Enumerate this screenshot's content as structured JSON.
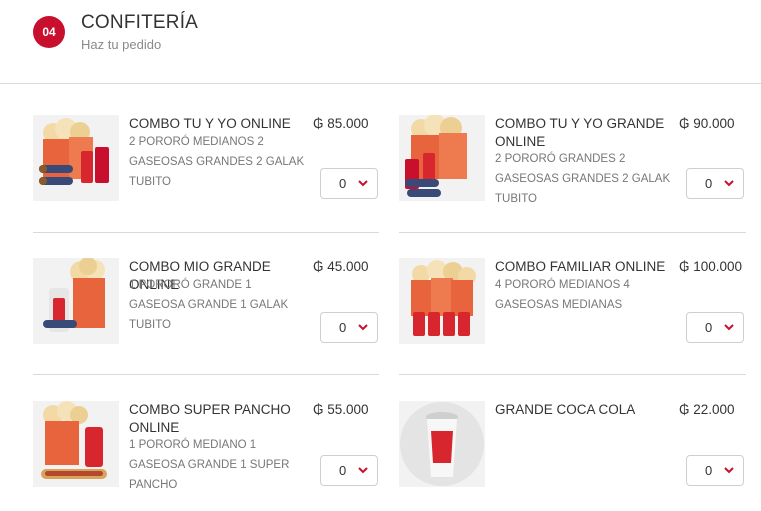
{
  "header": {
    "step": "04",
    "title": "CONFITERÍA",
    "subtitle": "Haz tu pedido"
  },
  "products": [
    {
      "name": "COMBO TU Y YO ONLINE",
      "description": "2 PORORÓ MEDIANOS 2 GASEOSAS GRANDES 2 GALAK TUBITO",
      "price": "₲ 85.000",
      "quantity": "0",
      "image": "popcorn-combo-2-icon"
    },
    {
      "name": "COMBO TU Y YO GRANDE ONLINE",
      "description": "2 PORORÓ GRANDES 2 GASEOSAS GRANDES 2 GALAK TUBITO",
      "price": "₲ 90.000",
      "quantity": "0",
      "image": "popcorn-combo-2-large-icon"
    },
    {
      "name": "COMBO MIO GRANDE ONLINE",
      "description": "1 PORORÓ GRANDE 1 GASEOSA GRANDE 1 GALAK TUBITO",
      "price": "₲ 45.000",
      "quantity": "0",
      "image": "popcorn-combo-1-icon"
    },
    {
      "name": "COMBO FAMILIAR ONLINE",
      "description": "4 PORORÓ MEDIANOS 4 GASEOSAS MEDIANAS",
      "price": "₲ 100.000",
      "quantity": "0",
      "image": "popcorn-family-combo-icon"
    },
    {
      "name": "COMBO SUPER PANCHO ONLINE",
      "description": "1 PORORÓ MEDIANO 1 GASEOSA GRANDE 1 SUPER PANCHO",
      "price": "₲ 55.000",
      "quantity": "0",
      "image": "popcorn-hotdog-combo-icon"
    },
    {
      "name": "GRANDE COCA COLA",
      "description": "",
      "price": "₲ 22.000",
      "quantity": "0",
      "image": "soda-cup-icon"
    }
  ],
  "colors": {
    "accent": "#c8102e",
    "popcorn_box": "#e8643c",
    "soda_cup": "#d8262f"
  }
}
